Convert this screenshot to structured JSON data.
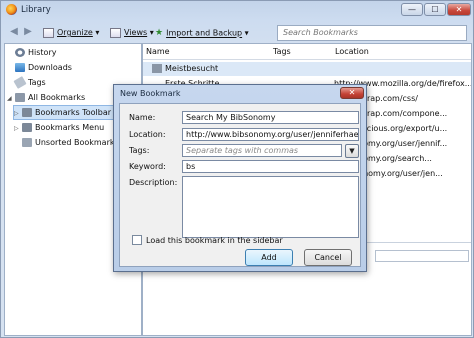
{
  "window": {
    "title": "Library",
    "controls": {
      "minimize": "—",
      "maximize": "☐",
      "close": "✕"
    }
  },
  "toolbar": {
    "organize": "Organize",
    "views": "Views",
    "import_backup": "Import and Backup",
    "search_placeholder": "Search Bookmarks"
  },
  "sidebar": {
    "items": [
      {
        "label": "History",
        "icon": "history-icon"
      },
      {
        "label": "Downloads",
        "icon": "downloads-icon"
      },
      {
        "label": "Tags",
        "icon": "tag-icon"
      },
      {
        "label": "All Bookmarks",
        "icon": "bookmarks-icon"
      },
      {
        "label": "Bookmarks Toolbar",
        "icon": "toolbar-folder-icon"
      },
      {
        "label": "Bookmarks Menu",
        "icon": "menu-folder-icon"
      },
      {
        "label": "Unsorted Bookmarks",
        "icon": "unsorted-folder-icon"
      }
    ]
  },
  "list": {
    "columns": [
      "Name",
      "Tags",
      "Location"
    ],
    "rows": [
      {
        "name": "Meistbesucht",
        "location": ""
      },
      {
        "name": "Erste Schritte",
        "location": "http://www.mozilla.org/de/firefox..."
      },
      {
        "name": "",
        "location": "...bootstrap.com/css/"
      },
      {
        "name": "",
        "location": "...bootstrap.com/compone..."
      },
      {
        "name": "",
        "location": "...w.biblicious.org/export/u..."
      },
      {
        "name": "",
        "location": "...ibsonomy.org/user/jennif..."
      },
      {
        "name": "",
        "location": "...ibsonomy.org/search..."
      },
      {
        "name": "",
        "location": "...bibsonomy.org/user/jen..."
      }
    ]
  },
  "dialog": {
    "title": "New Bookmark",
    "close": "✕",
    "name_label": "Name:",
    "name_value": "Search My BibSonomy",
    "location_label": "Location:",
    "location_value": "http://www.bibsonomy.org/user/jenniferhaefne",
    "tags_label": "Tags:",
    "tags_placeholder": "Separate tags with commas",
    "keyword_label": "Keyword:",
    "keyword_value": "bs",
    "description_label": "Description:",
    "description_value": "",
    "sidebar_checkbox_label": "Load this bookmark in the sidebar",
    "sidebar_checkbox_checked": false,
    "add_button": "Add",
    "cancel_button": "Cancel"
  },
  "colors": {
    "titlebar": "#c3d4ea",
    "close_red": "#c8473a",
    "selection": "#cfe3f8",
    "add_button_tint": "#bee6fd"
  }
}
